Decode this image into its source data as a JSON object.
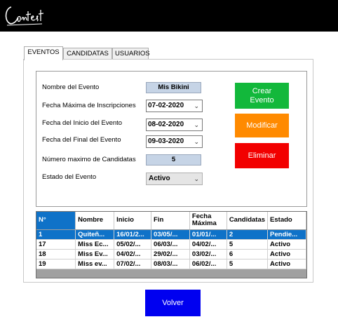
{
  "header": {
    "logo_text": "Contest",
    "colors": {
      "bar": "#000000"
    }
  },
  "tabs": [
    {
      "label": "EVENTOS",
      "active": true
    },
    {
      "label": "CANDIDATAS",
      "active": false
    },
    {
      "label": "USUARIOS",
      "active": false
    }
  ],
  "form": {
    "nombre_label": "Nombre del Evento",
    "nombre_value": "Mis Bikini",
    "fecha_max_label": "Fecha Máxima de Inscripciones",
    "fecha_max_value": "07-02-2020",
    "fecha_inicio_label": "Fecha del Inicio del Evento",
    "fecha_inicio_value": "08-02-2020",
    "fecha_final_label": "Fecha del Final del Evento",
    "fecha_final_value": "09-03-2020",
    "num_max_label": "Número maximo de Candidatas",
    "num_max_value": "5",
    "estado_label": "Estado del Evento",
    "estado_value": "Activo"
  },
  "buttons": {
    "crear": "Crear Evento",
    "modificar": "Modificar",
    "eliminar": "Eliminar",
    "volver": "Volver",
    "colors": {
      "crear": "#12b83b",
      "modificar": "#ff8a00",
      "eliminar": "#f20000",
      "volver": "#0000f0"
    }
  },
  "table": {
    "columns": [
      "N°",
      "Nombre",
      "Inicio",
      "Fin",
      "Fecha Máxima",
      "Candidatas",
      "Estado"
    ],
    "rows": [
      [
        "1",
        "Quiteñ...",
        "16/01/2...",
        "03/05/...",
        "01/01/...",
        "2",
        "Pendie..."
      ],
      [
        "17",
        "Miss Ec...",
        "05/02/...",
        "06/03/...",
        "04/02/...",
        "5",
        "Activo"
      ],
      [
        "18",
        "Miss Ev...",
        "04/02/...",
        "29/02/...",
        "03/02/...",
        "6",
        "Activo"
      ],
      [
        "19",
        "Miss ev...",
        "07/02/...",
        "08/03/...",
        "06/02/...",
        "5",
        "Activo"
      ]
    ],
    "selected_row": 0,
    "selection_color": "#0f72c8"
  },
  "icons": {
    "dropdown": "chevron-down-icon"
  }
}
